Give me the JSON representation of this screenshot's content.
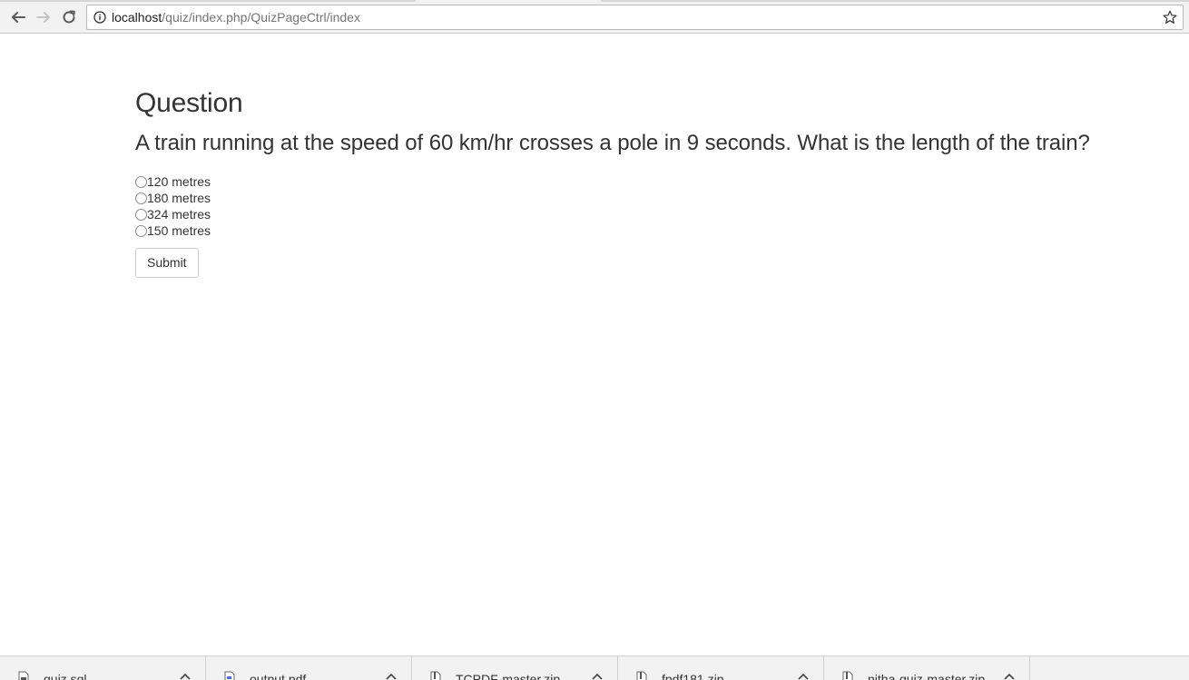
{
  "browser": {
    "url_host": "localhost",
    "url_path": "/quiz/index.php/QuizPageCtrl/index"
  },
  "quiz": {
    "heading": "Question",
    "question": "A train running at the speed of 60 km/hr crosses a pole in 9 seconds. What is the length of the train?",
    "options": [
      "120 metres",
      "180 metres",
      "324 metres",
      "150 metres"
    ],
    "submit_label": "Submit"
  },
  "downloads": {
    "items": [
      "quiz.sql",
      "output.pdf",
      "TCPDF-master.zip",
      "fpdf181.zip",
      "nitha-quiz-master.zip"
    ]
  }
}
